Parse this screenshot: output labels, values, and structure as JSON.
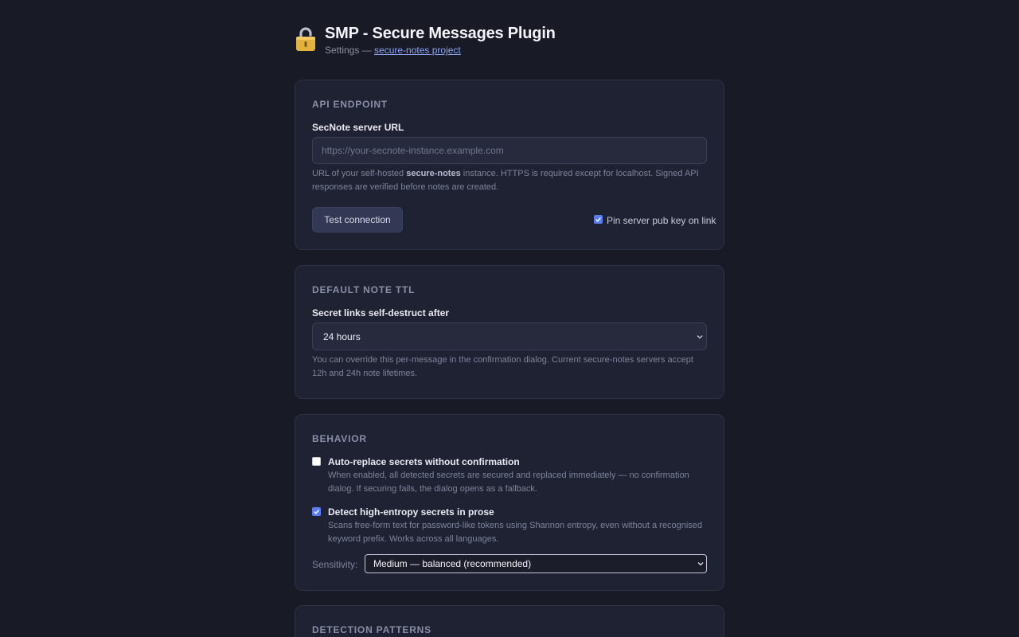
{
  "header": {
    "title": "SMP - Secure Messages Plugin",
    "subtitle_prefix": "Settings —",
    "project_link": "secure-notes project",
    "icon": "lock-icon"
  },
  "api": {
    "section_title": "API ENDPOINT",
    "url_label": "SecNote server URL",
    "url_value": "",
    "url_placeholder": "https://your-secnote-instance.example.com",
    "help_pre": "URL of your self-hosted",
    "help_bold": "secure-notes",
    "help_post": "instance. HTTPS is required except for localhost. Signed API responses are verified before notes are created.",
    "test_button": "Test connection",
    "pin_label": "Pin server pub key on link",
    "pin_checked": true
  },
  "ttl": {
    "section_title": "DEFAULT NOTE TTL",
    "label": "Secret links self-destruct after",
    "selected": "24 hours",
    "help": "You can override this per-message in the confirmation dialog. Current secure-notes servers accept 12h and 24h note lifetimes."
  },
  "behavior": {
    "section_title": "BEHAVIOR",
    "auto_replace": {
      "title": "Auto-replace secrets without confirmation",
      "help": "When enabled, all detected secrets are secured and replaced immediately — no confirmation dialog. If securing fails, the dialog opens as a fallback.",
      "checked": false
    },
    "entropy": {
      "title": "Detect high-entropy secrets in prose",
      "help": "Scans free-form text for password-like tokens using Shannon entropy, even without a recognised keyword prefix. Works across all languages.",
      "checked": true
    },
    "sensitivity_label": "Sensitivity:",
    "sensitivity_selected": "Medium — balanced (recommended)"
  },
  "patterns": {
    "section_title": "DETECTION PATTERNS"
  },
  "colors": {
    "background": "#181a26",
    "card": "#1f2232",
    "accent": "#5b7cf5",
    "link": "#8ea4f0"
  }
}
